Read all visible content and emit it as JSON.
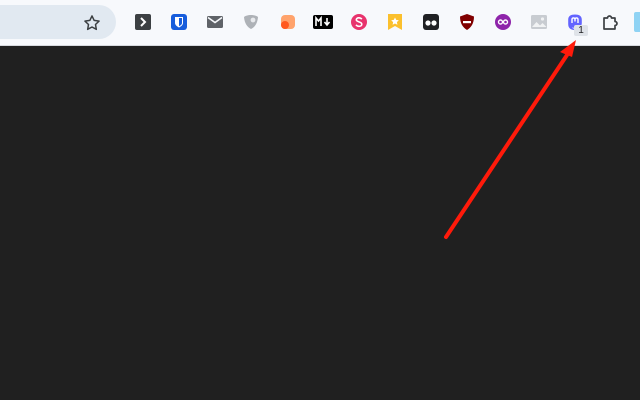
{
  "toolbar": {
    "bookmark_star_icon": "star-outline-icon",
    "extensions": [
      {
        "name": "terminal-extension",
        "icon": "chevron-right-icon",
        "color": "#3c4043"
      },
      {
        "name": "bitwarden-extension",
        "icon": "shield-icon",
        "color": "#175ddc"
      },
      {
        "name": "mail-extension",
        "icon": "envelope-icon",
        "color": "#5f6368"
      },
      {
        "name": "gray-shield-extension",
        "icon": "shield-gray-icon",
        "color": "#9aa0a6"
      },
      {
        "name": "orange-extension",
        "icon": "orange-blob-icon",
        "color": "#ff7a2f"
      },
      {
        "name": "markdown-extension",
        "icon": "markdown-icon",
        "label": "M↓",
        "color": "#000000"
      },
      {
        "name": "s-extension",
        "icon": "s-circle-icon",
        "label": "S",
        "color": "#e8336d"
      },
      {
        "name": "bookmark-extension",
        "icon": "bookmark-star-icon",
        "color": "#fbc02d"
      },
      {
        "name": "tabs-extension",
        "icon": "two-dots-icon",
        "color": "#202124"
      },
      {
        "name": "ublock-extension",
        "icon": "red-shield-icon",
        "color": "#800000"
      },
      {
        "name": "purple-extension",
        "icon": "purple-circle-icon",
        "color": "#8e24aa"
      },
      {
        "name": "image-extension",
        "icon": "image-icon",
        "color": "#bdc1c6"
      },
      {
        "name": "mastodon-extension",
        "icon": "mastodon-icon",
        "color": "#6364ff",
        "badge": "1"
      }
    ],
    "puzzle_icon": "puzzle-piece-icon"
  },
  "colors": {
    "toolbar_bg": "#f7f9fc",
    "content_bg": "#202020",
    "annotation_arrow": "#ff1a0a"
  }
}
